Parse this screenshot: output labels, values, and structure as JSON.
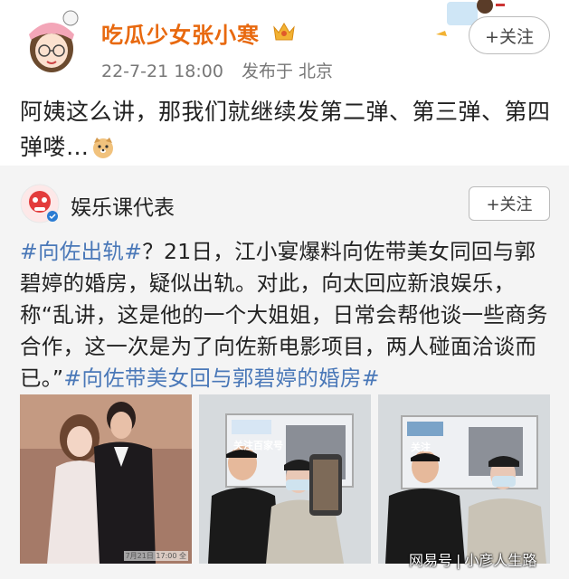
{
  "post": {
    "username": "吃瓜少女张小寒",
    "date": "22-7-21 18:00",
    "published_in": "发布于 北京",
    "follow_label": "+关注",
    "text": "阿姨这么讲，那我们就继续发第二弹、第三弹、第四弹喽…"
  },
  "repost": {
    "author": "娱乐课代表",
    "follow_label": "+关注",
    "tag1": "#向佐出轨#",
    "body": "？21日，江小宴爆料向佐带美女同回与郭碧婷的婚房，疑似出轨。对此，向太回应新浪娱乐，称“乱讲，这是他的一个大姐姐，日常会帮他谈一些商务合作，这一次是为了向佐新电影项目，两人碰面洽谈而已。”",
    "tag2": "#向佐带美女回与郭碧婷的婚房#",
    "photo1_stamp": "7月21日 17:00 全",
    "photo2_sign": "关注百家号",
    "photo3_sign": "关注"
  },
  "watermark": {
    "source": "网易号",
    "author": "小彦人生路"
  },
  "colors": {
    "username": "#e8690f",
    "hashtag": "#4a78b8",
    "repost_bg": "#f4f4f4"
  }
}
